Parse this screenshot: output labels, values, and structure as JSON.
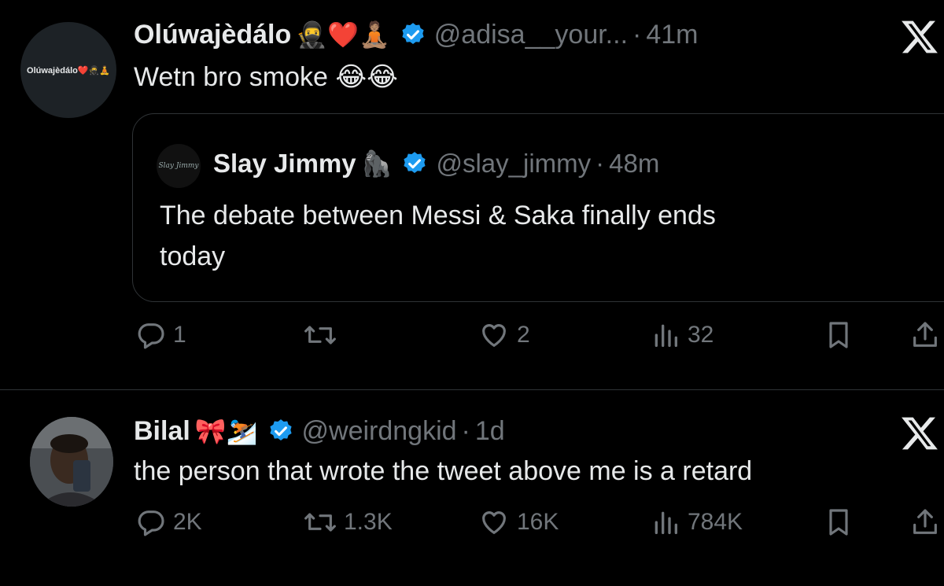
{
  "tweets": [
    {
      "author": {
        "name": "Olúwajèdálo",
        "emojis": "🥷❤️🧘🏽",
        "handle": "@adisa__your...",
        "avatar_text": "Olúwajèdálo❤️🥷🧘"
      },
      "separator": "·",
      "time": "41m",
      "text": "Wetn bro smoke 😂😂",
      "quote": {
        "author": {
          "name": "Slay Jimmy",
          "emojis": "🦍",
          "handle": "@slay_jimmy",
          "avatar_text": "Slay Jimmy"
        },
        "time": "48m",
        "text_line1": "The debate between Messi & Saka finally ends",
        "text_line2": "today"
      },
      "actions": {
        "replies": "1",
        "retweets": "",
        "likes": "2",
        "views": "32"
      }
    },
    {
      "author": {
        "name": "Bilal",
        "emojis": "🎀⛷️",
        "handle": "@weirdngkid"
      },
      "separator": "·",
      "time": "1d",
      "text": "the person that wrote the tweet above me is a retard",
      "actions": {
        "replies": "2K",
        "retweets": "1.3K",
        "likes": "16K",
        "views": "784K"
      }
    }
  ],
  "icons": {
    "reply": "reply-icon",
    "retweet": "retweet-icon",
    "like": "heart-icon",
    "views": "views-icon",
    "bookmark": "bookmark-icon",
    "share": "share-icon",
    "verified": "verified-badge-icon",
    "x": "x-logo-icon"
  },
  "colors": {
    "background": "#000000",
    "text": "#e7e9ea",
    "muted": "#71767b",
    "verified": "#1d9bf0",
    "border": "#2f3336"
  }
}
